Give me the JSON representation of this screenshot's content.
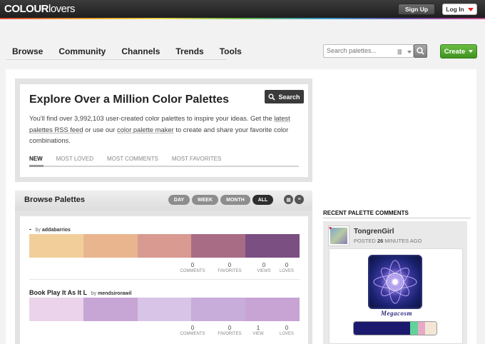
{
  "header": {
    "logo_bold": "COLOUR",
    "logo_thin": "lovers",
    "signup": "Sign Up",
    "login": "Log In"
  },
  "nav": {
    "items": [
      "Browse",
      "Community",
      "Channels",
      "Trends",
      "Tools"
    ],
    "search_placeholder": "Search palettes...",
    "create": "Create"
  },
  "explore": {
    "title": "Explore Over a Million Color Palettes",
    "search_btn": "Search",
    "text_1": "You'll find over 3,992,103 user-created color palettes to inspire your ideas. Get the ",
    "link_1": "latest palettes RSS feed",
    "text_2": " or use our ",
    "link_2": "color palette maker",
    "text_3": " to create and share your favorite color combinations.",
    "tabs": [
      "NEW",
      "MOST LOVED",
      "MOST COMMENTS",
      "MOST FAVORITES"
    ]
  },
  "browse": {
    "title": "Browse Palettes",
    "ranges": [
      "DAY",
      "WEEK",
      "MONTH",
      "ALL"
    ],
    "active_range": "ALL",
    "palettes": [
      {
        "title": "-",
        "by_label": "by",
        "author": "addabarrios",
        "colors": [
          "#f2cf9a",
          "#e9b58f",
          "#d89a91",
          "#a96c85",
          "#7b4f82"
        ],
        "stats": [
          {
            "n": "0",
            "l": "COMMENTS"
          },
          {
            "n": "0",
            "l": "FAVORITES"
          },
          {
            "n": "0",
            "l": "VIEWS"
          },
          {
            "n": "0",
            "l": "LOVES"
          }
        ]
      },
      {
        "title": "Book Play It As It L",
        "by_label": "by",
        "author": "mendsirorawil",
        "colors": [
          "#ebd3ec",
          "#c7a6d6",
          "#d8c4e6",
          "#c8acd9",
          "#c7a4d4"
        ],
        "stats": [
          {
            "n": "0",
            "l": "COMMENTS"
          },
          {
            "n": "0",
            "l": "FAVORITES"
          },
          {
            "n": "1",
            "l": "VIEW"
          },
          {
            "n": "0",
            "l": "LOVES"
          }
        ]
      }
    ]
  },
  "recent": {
    "title": "RECENT PALETTE COMMENTS",
    "user": "TongrenGirl",
    "posted_pre": "POSTED ",
    "posted_num": "26",
    "posted_post": " MINUTES AGO",
    "caption": "Megacosm",
    "mini_colors": [
      "#1c1a6e",
      "#1c1a6e",
      "#5fd39a",
      "#e8a8c8",
      "#f3e6d4"
    ]
  },
  "colors": {
    "create_green": "#4fa52c",
    "dark_bar": "#2a2a2a",
    "login_arrow": "#d22222"
  }
}
